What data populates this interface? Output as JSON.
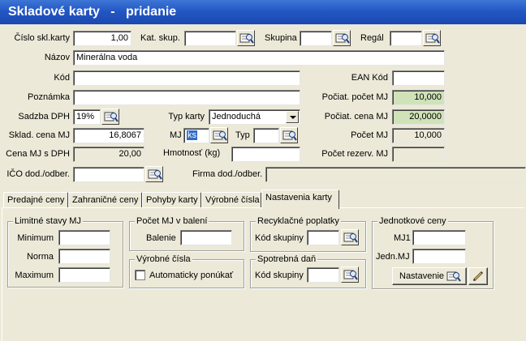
{
  "window": {
    "title": "Skladové karty   -   pridanie"
  },
  "form": {
    "cislo_label": "Číslo skl.karty",
    "cislo_value": "1,00",
    "kat_skup_label": "Kat. skup.",
    "kat_skup_value": "",
    "skupina_label": "Skupina",
    "skupina_value": "",
    "regal_label": "Regál",
    "regal_value": "",
    "nazov_label": "Názov",
    "nazov_value": "Minerálna voda",
    "kod_label": "Kód",
    "kod_value": "",
    "ean_label": "EAN Kód",
    "ean_value": "",
    "poznamka_label": "Poznámka",
    "poznamka_value": "",
    "pociat_pocet_label": "Počiat. počet MJ",
    "pociat_pocet_value": "10,000",
    "sadzba_label": "Sadzba DPH",
    "sadzba_value": "19%",
    "typ_karty_label": "Typ karty",
    "typ_karty_value": "Jednoduchá",
    "pociat_cena_label": "Počiat. cena MJ",
    "pociat_cena_value": "20,0000",
    "sklad_cena_label": "Sklad. cena MJ",
    "sklad_cena_value": "16,8067",
    "mj_label": "MJ",
    "mj_value": "ks",
    "typ_label": "Typ",
    "typ_value": "",
    "pocet_mj_label": "Počet MJ",
    "pocet_mj_value": "10,000",
    "cena_dph_label": "Cena MJ s DPH",
    "cena_dph_value": "20,00",
    "hmotnost_label": "Hmotnosť (kg)",
    "hmotnost_value": "",
    "pocet_rezerv_label": "Počet rezerv. MJ",
    "pocet_rezerv_value": "",
    "ico_label": "IČO dod./odber.",
    "ico_value": "",
    "firma_label": "Firma dod./odber.",
    "firma_value": ""
  },
  "tabs": [
    {
      "label": "Predajné ceny"
    },
    {
      "label": "Zahraničné ceny"
    },
    {
      "label": "Pohyby karty"
    },
    {
      "label": "Výrobné čísla"
    },
    {
      "label": "Nastavenia karty"
    }
  ],
  "settings": {
    "limitne": {
      "title": "Limitné stavy MJ",
      "minimum_label": "Minimum",
      "minimum_value": "",
      "norma_label": "Norma",
      "norma_value": "",
      "maximum_label": "Maximum",
      "maximum_value": ""
    },
    "balenie": {
      "title": "Počet MJ v balení",
      "label": "Balenie",
      "value": ""
    },
    "vyrobne": {
      "title": "Výrobné čísla",
      "checkbox_label": "Automaticky ponúkať",
      "checked": false
    },
    "recykl": {
      "title": "Recyklačné poplatky",
      "label": "Kód skupiny",
      "value": ""
    },
    "spotrebna": {
      "title": "Spotrebná daň",
      "label": "Kód skupiny",
      "value": ""
    },
    "jednotkove": {
      "title": "Jednotkové ceny",
      "mj1_label": "MJ1",
      "mj1_value": "",
      "jedn_label": "Jedn.MJ",
      "jedn_value": "",
      "nastavenie_label": "Nastavenie"
    }
  },
  "colors": {
    "title_bar": "#2457c4",
    "highlight_field": "#cfe2b8",
    "selection": "#316ac5"
  }
}
